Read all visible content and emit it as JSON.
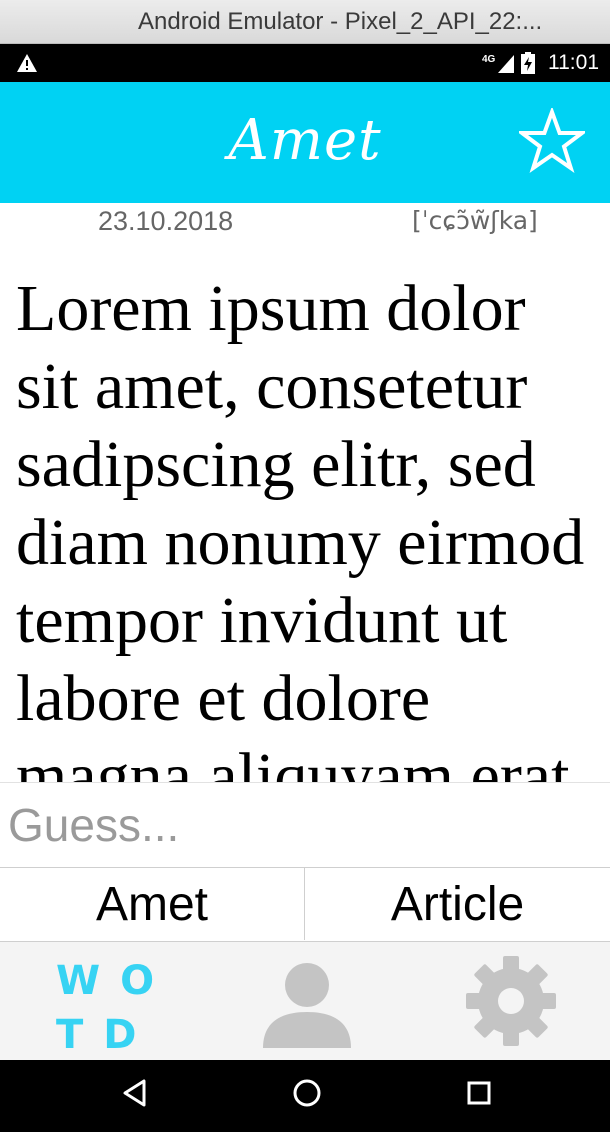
{
  "window": {
    "title": "Android Emulator - Pixel_2_API_22:..."
  },
  "status_bar": {
    "network": "4G",
    "time": "11:01",
    "icons": [
      "warning-icon",
      "signal-icon",
      "battery-charging-icon"
    ]
  },
  "app_bar": {
    "word": "Amet",
    "favorite_icon": "star-outline-icon",
    "color": "#00d2f3"
  },
  "meta": {
    "date": "23.10.2018",
    "pronunciation": "[ˈcɕɔ̃w̃ʃka]"
  },
  "article": {
    "text": "Lorem ipsum dolor sit amet, consetetur sadipscing elitr, sed diam nonumy eirmod tempor invidunt ut labore et dolore magna aliquyam erat, sed diam voluptua."
  },
  "guess": {
    "placeholder": "Guess...",
    "value": ""
  },
  "answers": [
    {
      "label": "Amet"
    },
    {
      "label": "Article"
    }
  ],
  "bottom_nav": {
    "wotd_letters": [
      "WO",
      "TD"
    ],
    "active_color": "#37d3f3",
    "inactive_color": "#c4c4c4",
    "items": [
      "wotd-logo",
      "person-icon",
      "gear-icon"
    ]
  },
  "system_nav": {
    "icons": [
      "back-icon",
      "home-icon",
      "recents-icon"
    ]
  }
}
